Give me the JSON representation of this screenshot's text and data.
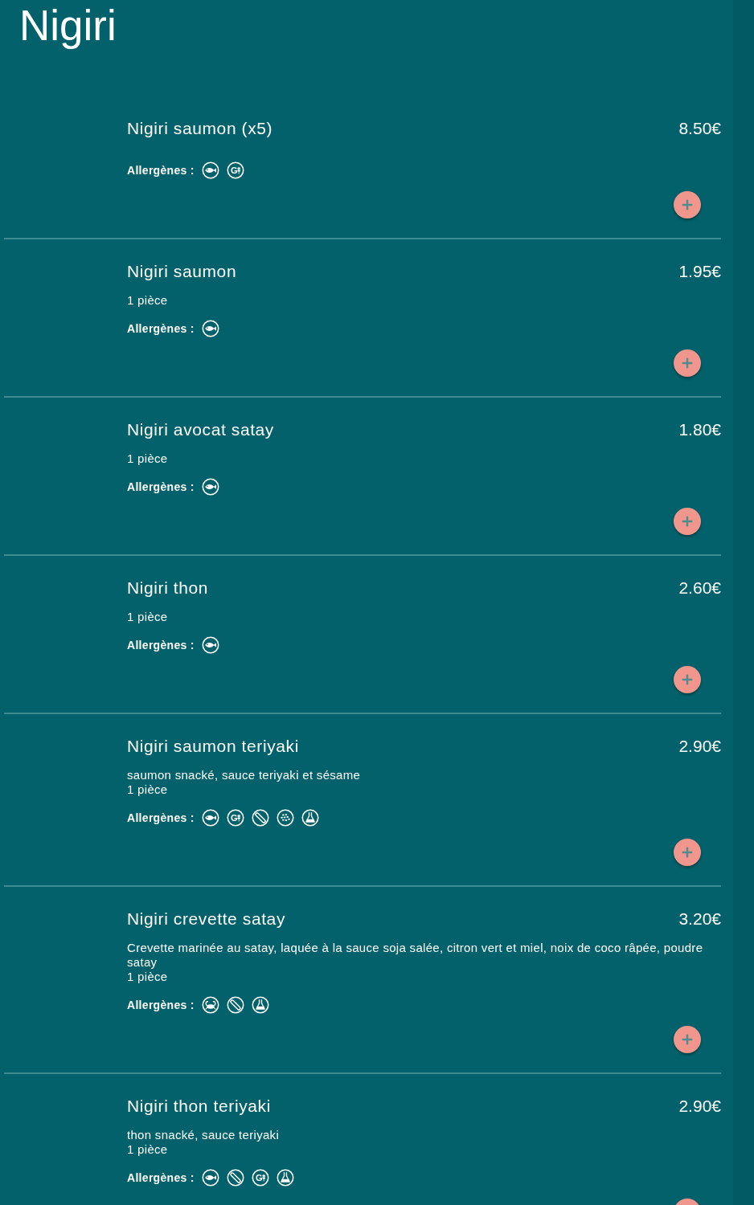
{
  "section": {
    "title": "Nigiri"
  },
  "items": [
    {
      "name": "Nigiri saumon (x5)",
      "price": "8.50€",
      "allergens_label": "Allergènes :",
      "allergens": [
        {
          "kind": "fish"
        },
        {
          "kind": "gluten",
          "label": "G"
        }
      ]
    },
    {
      "name": "Nigiri saumon",
      "price": "1.95€",
      "portion": "1 pièce",
      "allergens_label": "Allergènes :",
      "allergens": [
        {
          "kind": "fish"
        }
      ]
    },
    {
      "name": "Nigiri avocat satay",
      "price": "1.80€",
      "portion": "1 pièce",
      "allergens_label": "Allergènes :",
      "allergens": [
        {
          "kind": "fish"
        }
      ]
    },
    {
      "name": "Nigiri thon",
      "price": "2.60€",
      "portion": "1 pièce",
      "allergens_label": "Allergènes :",
      "allergens": [
        {
          "kind": "fish"
        }
      ]
    },
    {
      "name": "Nigiri saumon teriyaki",
      "price": "2.90€",
      "description": "saumon snacké, sauce teriyaki et sésame",
      "portion": "1 pièce",
      "allergens_label": "Allergènes :",
      "allergens": [
        {
          "kind": "fish"
        },
        {
          "kind": "gluten",
          "label": "G"
        },
        {
          "kind": "soy"
        },
        {
          "kind": "sesame"
        },
        {
          "kind": "flask"
        }
      ]
    },
    {
      "name": "Nigiri crevette satay",
      "price": "3.20€",
      "description": "Crevette marinée au satay, laquée à la sauce soja salée, citron vert et miel, noix de coco râpée, poudre satay",
      "portion": "1 pièce",
      "allergens_label": "Allergènes :",
      "allergens": [
        {
          "kind": "crab"
        },
        {
          "kind": "soy"
        },
        {
          "kind": "flask"
        }
      ]
    },
    {
      "name": "Nigiri thon teriyaki",
      "price": "2.90€",
      "description": "thon snacké, sauce teriyaki",
      "portion": "1 pièce",
      "allergens_label": "Allergènes :",
      "allergens": [
        {
          "kind": "fish"
        },
        {
          "kind": "soy"
        },
        {
          "kind": "gluten",
          "label": "G"
        },
        {
          "kind": "flask"
        }
      ]
    }
  ]
}
